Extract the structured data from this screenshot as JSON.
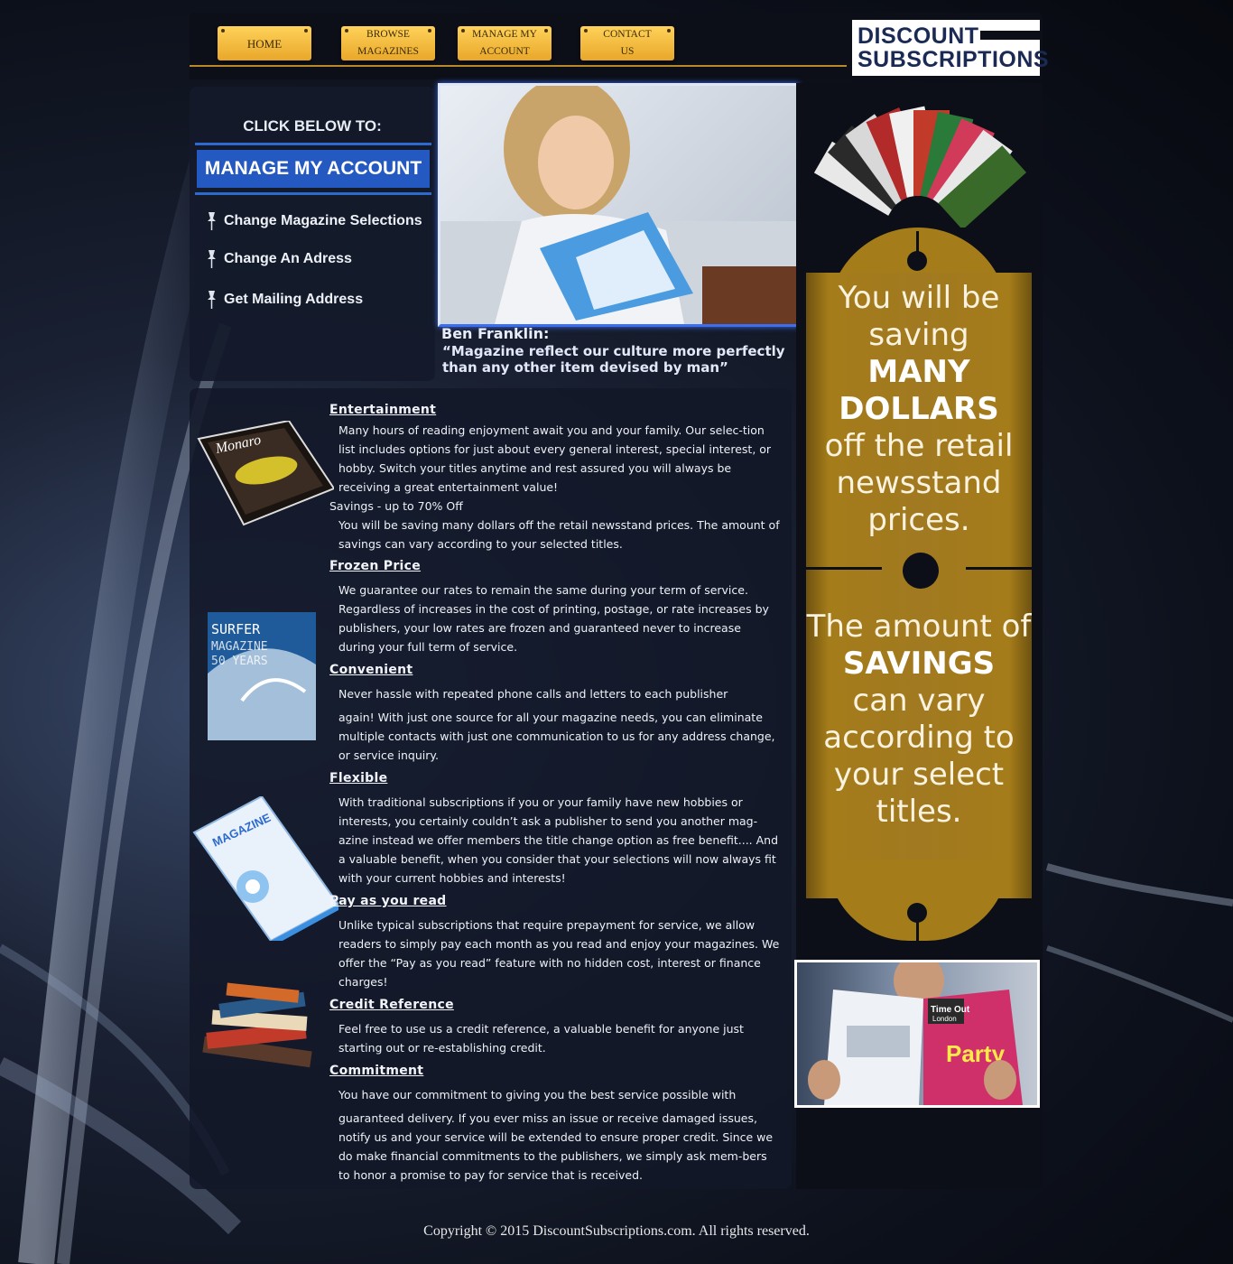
{
  "nav": {
    "home": "HOME",
    "browse_l1": "BROWSE",
    "browse_l2": "MAGAZINES",
    "manage_l1": "MANAGE MY",
    "manage_l2": "ACCOUNT",
    "contact_l1": "CONTACT",
    "contact_l2": "US"
  },
  "logo": {
    "line1": "DISCOUNT",
    "line2": "SUBSCRIPTIONS"
  },
  "account_panel": {
    "title": "CLICK BELOW TO:",
    "manage_button": "MANAGE MY ACCOUNT",
    "links": [
      "Change Magazine Selections",
      "Change An Adress",
      "Get Mailing Address"
    ]
  },
  "quote": {
    "author": "Ben Franklin:",
    "text": "“Magazine reflect our culture more perfectly than any other item devised by man”"
  },
  "sections": [
    {
      "title": "Entertainment",
      "paragraphs": [
        "Many hours of reading enjoyment await you and your family. Our selec-tion list includes options for just about every general interest, special interest, or hobby. Switch your titles anytime and rest assured you will always be receiving a great entertainment value!",
        "Savings - up to 70% Off",
        "You will be saving many dollars off the retail newsstand prices. The amount of savings can vary according to your selected titles."
      ]
    },
    {
      "title": "Frozen Price",
      "paragraphs": [
        "We guarantee our rates to remain the same during your term of service. Regardless of increases in the cost of printing, postage, or rate increases by publishers, your low rates are frozen and guaranteed never to increase during your full term of service."
      ]
    },
    {
      "title": "Convenient",
      "paragraphs": [
        "Never hassle with repeated phone calls and letters to each publisher",
        "again! With just one source for all your magazine needs, you can eliminate multiple contacts with just one communication to us for any address change, or service inquiry."
      ]
    },
    {
      "title": "Flexible",
      "paragraphs": [
        "With traditional subscriptions if you or your family have new hobbies or interests, you certainly couldn’t ask a publisher to send you another mag-azine instead we offer members the title change option as free benefit.... And a valuable benefit, when you consider that your selections will now always fit with your current hobbies and interests!"
      ]
    },
    {
      "title": "Pay as you read",
      "paragraphs": [
        "Unlike typical subscriptions that require prepayment for service, we allow readers to simply pay each month as you read and enjoy your magazines. We offer the “Pay as you read” feature with no hidden cost, interest or finance charges!"
      ]
    },
    {
      "title": "Credit Reference",
      "paragraphs": [
        "Feel free to use us a credit reference, a valuable benefit for anyone just starting out or re-establishing credit."
      ]
    },
    {
      "title": "Commitment",
      "paragraphs": [
        "You have our commitment to giving you the best service possible with",
        "guaranteed delivery. If you ever miss an issue or receive damaged issues, notify us and your service will be extended to ensure proper credit. Since we do make financial commitments to the publishers, we simply ask mem-bers to honor a promise to pay for service that is received."
      ]
    }
  ],
  "book_covers": {
    "monaro": "Monaro",
    "surfer": "SURFER",
    "surfer_sub": "MAGAZINE",
    "surfer_years": "50 YEARS",
    "your_mag": "MAGAZINE"
  },
  "promo": {
    "l1": "You will be",
    "l2": "saving",
    "l3": "MANY",
    "l4": "DOLLARS",
    "l5": "off the retail",
    "l6": "newsstand",
    "l7": "prices.",
    "m1": "The amount of",
    "m2": "SAVINGS",
    "m3": "can vary",
    "m4": "according to",
    "m5": "your select",
    "m6": "titles."
  },
  "magazine_photo": {
    "timeout": "Time Out",
    "london": "London",
    "party": "Party"
  },
  "footer": "Copyright © 2015 DiscountSubscriptions.com. All rights reserved.",
  "colors": {
    "gold": "#a57c1a",
    "nav_gold": "#f6bd3e",
    "accent_blue": "#2459c2",
    "panel": "#141a2a"
  }
}
